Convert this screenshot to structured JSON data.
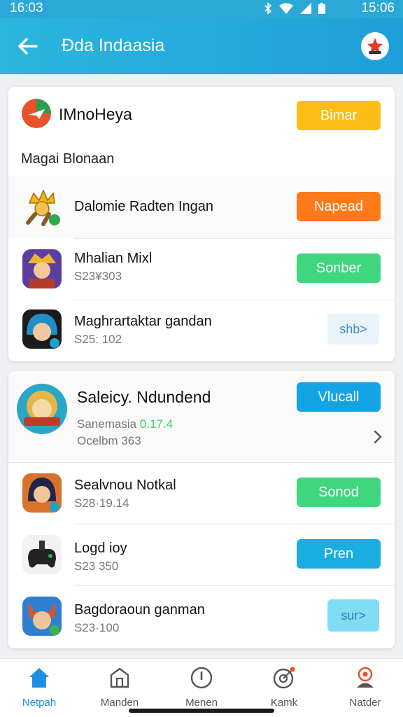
{
  "status_bar": {
    "time_left": "16:03",
    "time_right": "15:06"
  },
  "app_bar": {
    "title": "Ðda Indaasia"
  },
  "card1": {
    "title": "IMnoHeya",
    "action": "Bimar",
    "section_label": "Magai Blonaan",
    "rows": [
      {
        "title": "Dalomie Radten Ingan",
        "subtitle": "",
        "action": "Napead"
      },
      {
        "title": "Mhalian Mixl",
        "subtitle": "S23¥303",
        "action": "Sonber"
      },
      {
        "title": "Maghrartaktar gandan",
        "subtitle": "S25: 102",
        "action": "shb>"
      }
    ]
  },
  "card2": {
    "title": "Saleicy. Ndundend",
    "action": "Vlucall",
    "sub1": "Sanemasia",
    "sub1_value": "0.17.4",
    "sub2": "Ocelbm 363",
    "rows": [
      {
        "title": "Sealvnou Notkal",
        "subtitle": "S28·19.14",
        "action": "Sonod"
      },
      {
        "title": "Logd ioy",
        "subtitle": "S23 350",
        "action": "Pren"
      },
      {
        "title": "Bagdoraoun ganman",
        "subtitle": "S23·100",
        "action": "sur>"
      }
    ]
  },
  "bottom_nav": [
    {
      "label": "Netpah",
      "icon": "home-icon"
    },
    {
      "label": "Manden",
      "icon": "store-icon"
    },
    {
      "label": "Menen",
      "icon": "clock-icon"
    },
    {
      "label": "Kamk",
      "icon": "target-icon"
    },
    {
      "label": "Natder",
      "icon": "profile-icon"
    }
  ],
  "colors": {
    "accent": "#1e9fd8",
    "active_nav": "#1e8fe0",
    "orange": "#ff7a1a",
    "yellow": "#fbbd16",
    "green": "#3fd67d",
    "blue": "#14a4e6"
  }
}
